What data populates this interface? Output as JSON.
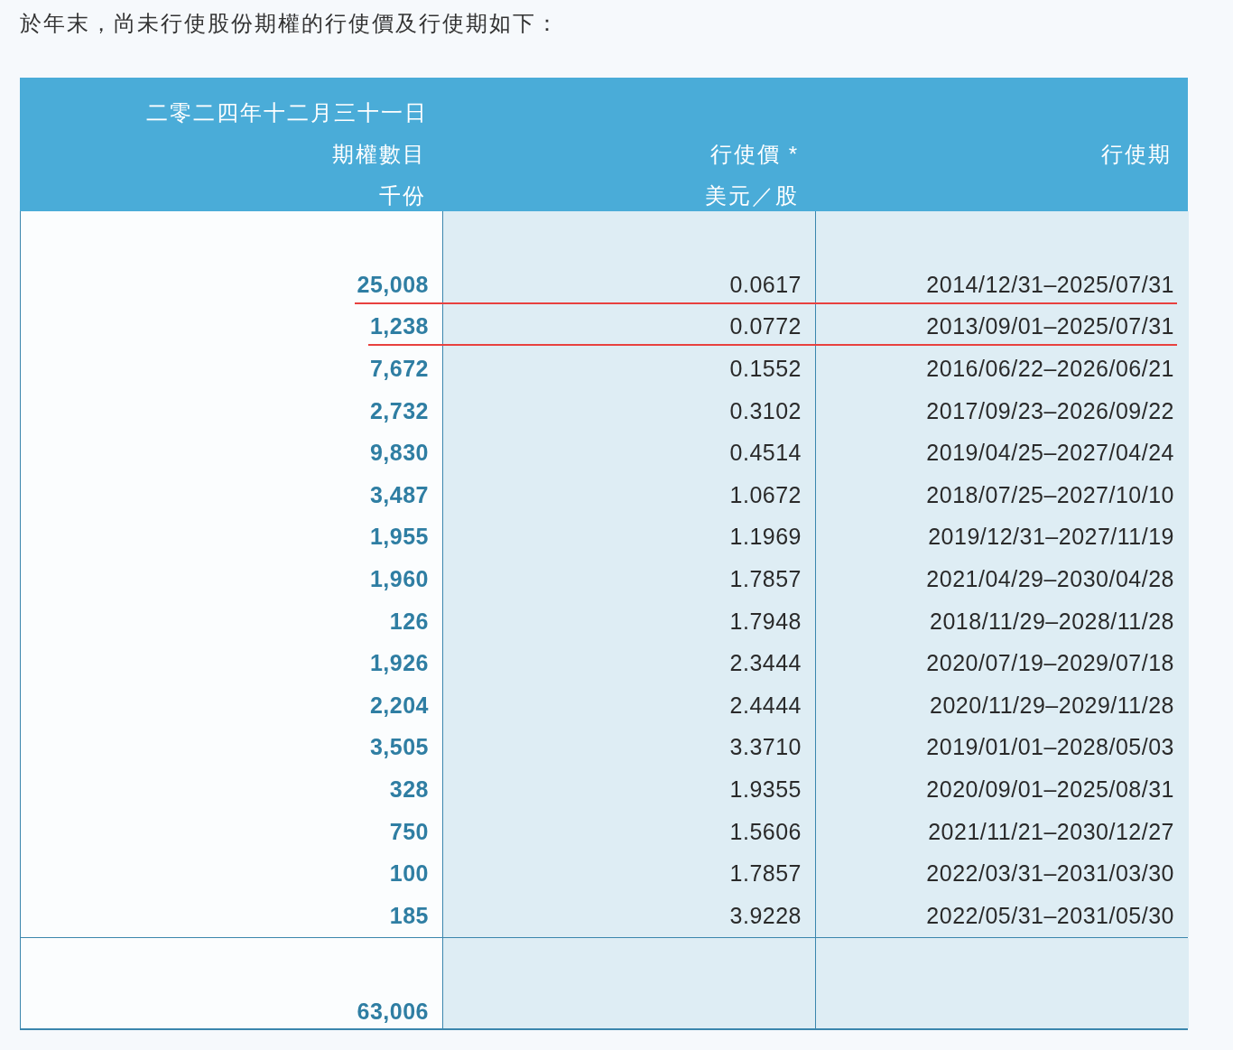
{
  "intro": "於年末，尚未行使股份期權的行使價及行使期如下：",
  "table": {
    "header": {
      "date": "二零二四年十二月三十一日",
      "columns": [
        {
          "title": "期權數目",
          "unit": "千份"
        },
        {
          "title": "行使價 *",
          "unit": "美元／股"
        },
        {
          "title": "行使期"
        }
      ]
    },
    "rows": [
      {
        "options": "25,008",
        "price": "0.0617",
        "period": "2014/12/31–2025/07/31",
        "underlined": true
      },
      {
        "options": "1,238",
        "price": "0.0772",
        "period": "2013/09/01–2025/07/31",
        "underlined": true
      },
      {
        "options": "7,672",
        "price": "0.1552",
        "period": "2016/06/22–2026/06/21",
        "underlined": false
      },
      {
        "options": "2,732",
        "price": "0.3102",
        "period": "2017/09/23–2026/09/22",
        "underlined": false
      },
      {
        "options": "9,830",
        "price": "0.4514",
        "period": "2019/04/25–2027/04/24",
        "underlined": false
      },
      {
        "options": "3,487",
        "price": "1.0672",
        "period": "2018/07/25–2027/10/10",
        "underlined": false
      },
      {
        "options": "1,955",
        "price": "1.1969",
        "period": "2019/12/31–2027/11/19",
        "underlined": false
      },
      {
        "options": "1,960",
        "price": "1.7857",
        "period": "2021/04/29–2030/04/28",
        "underlined": false
      },
      {
        "options": "126",
        "price": "1.7948",
        "period": "2018/11/29–2028/11/28",
        "underlined": false
      },
      {
        "options": "1,926",
        "price": "2.3444",
        "period": "2020/07/19–2029/07/18",
        "underlined": false
      },
      {
        "options": "2,204",
        "price": "2.4444",
        "period": "2020/11/29–2029/11/28",
        "underlined": false
      },
      {
        "options": "3,505",
        "price": "3.3710",
        "period": "2019/01/01–2028/05/03",
        "underlined": false
      },
      {
        "options": "328",
        "price": "1.9355",
        "period": "2020/09/01–2025/08/31",
        "underlined": false
      },
      {
        "options": "750",
        "price": "1.5606",
        "period": "2021/11/21–2030/12/27",
        "underlined": false
      },
      {
        "options": "100",
        "price": "1.7857",
        "period": "2022/03/31–2031/03/30",
        "underlined": false
      },
      {
        "options": "185",
        "price": "3.9228",
        "period": "2022/05/31–2031/05/30",
        "underlined": false
      }
    ],
    "total": "63,006"
  }
}
